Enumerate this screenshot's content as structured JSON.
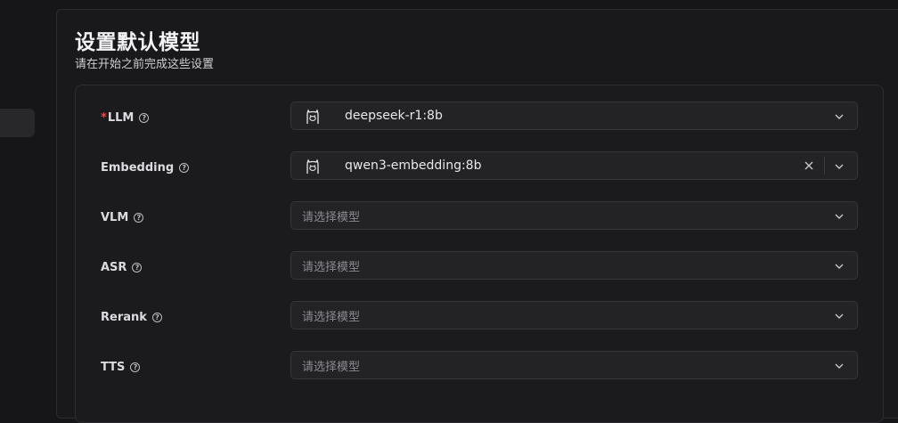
{
  "header": {
    "title": "设置默认模型",
    "subtitle": "请在开始之前完成这些设置"
  },
  "form": {
    "rows": [
      {
        "label": "LLM",
        "required": true,
        "value": "deepseek-r1:8b",
        "icon": "llama-icon",
        "clearable": false
      },
      {
        "label": "Embedding",
        "required": false,
        "value": "qwen3-embedding:8b",
        "icon": "llama-icon",
        "clearable": true
      },
      {
        "label": "VLM",
        "required": false,
        "placeholder": "请选择模型"
      },
      {
        "label": "ASR",
        "required": false,
        "placeholder": "请选择模型"
      },
      {
        "label": "Rerank",
        "required": false,
        "placeholder": "请选择模型"
      },
      {
        "label": "TTS",
        "required": false,
        "placeholder": "请选择模型"
      }
    ],
    "required_mark": "*",
    "help_glyph": "?"
  },
  "colors": {
    "background": "#161618",
    "panel": "#19191b",
    "input": "#232326",
    "required": "#e5484d",
    "placeholder": "#8a8a90"
  }
}
